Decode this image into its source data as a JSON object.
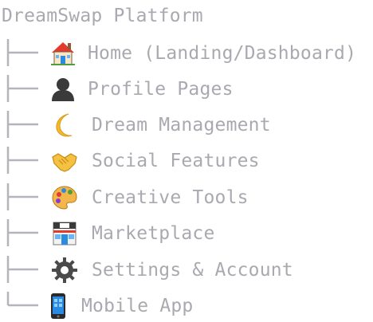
{
  "tree": {
    "root_label": "DreamSwap Platform",
    "children": [
      {
        "label": "Home (Landing/Dashboard)",
        "icon": "house-icon"
      },
      {
        "label": "Profile Pages",
        "icon": "person-silhouette-icon"
      },
      {
        "label": "Dream Management",
        "icon": "crescent-moon-icon"
      },
      {
        "label": "Social Features",
        "icon": "handshake-icon"
      },
      {
        "label": "Creative Tools",
        "icon": "artist-palette-icon"
      },
      {
        "label": "Marketplace",
        "icon": "convenience-store-icon"
      },
      {
        "label": "Settings & Account",
        "icon": "gear-icon"
      },
      {
        "label": "Mobile App",
        "icon": "mobile-phone-icon"
      }
    ]
  }
}
